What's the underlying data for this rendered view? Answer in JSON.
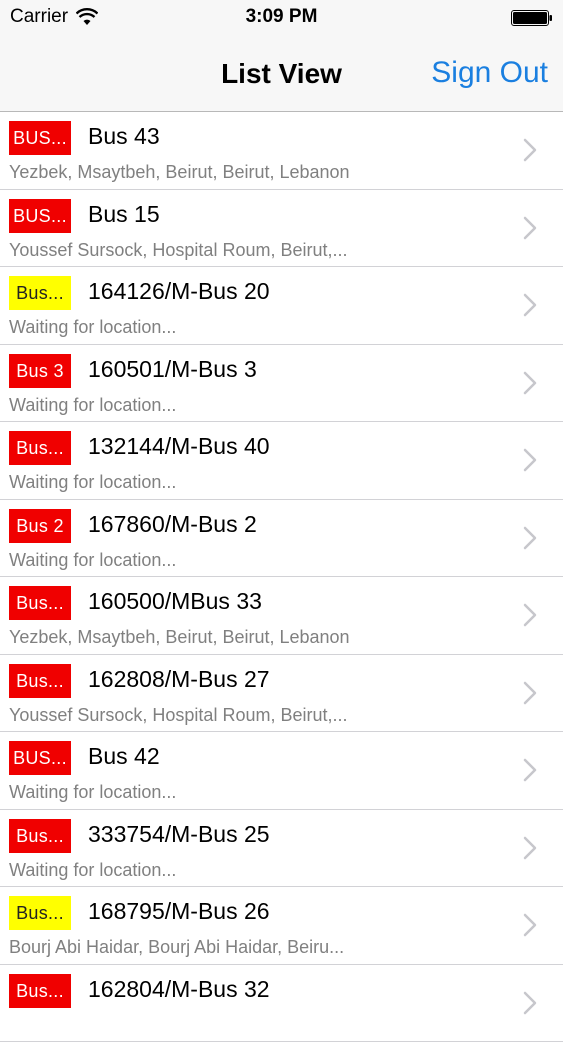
{
  "status_bar": {
    "carrier": "Carrier",
    "time": "3:09 PM"
  },
  "nav": {
    "title": "List View",
    "right_button": "Sign Out"
  },
  "colors": {
    "accent": "#1a7fe0",
    "badge_red": "#f00000",
    "badge_yellow": "#ffff00"
  },
  "rows": [
    {
      "badge": "BUS...",
      "badge_color": "#f00000",
      "title": "Bus 43",
      "subtitle": "Yezbek, Msaytbeh, Beirut, Beirut, Lebanon"
    },
    {
      "badge": "BUS...",
      "badge_color": "#f00000",
      "title": "Bus 15",
      "subtitle": "Youssef Sursock, Hospital Roum, Beirut,..."
    },
    {
      "badge": "Bus...",
      "badge_color": "#ffff00",
      "title": "164126/M-Bus 20",
      "subtitle": "Waiting for location..."
    },
    {
      "badge": "Bus 3",
      "badge_color": "#f00000",
      "title": "160501/M-Bus 3",
      "subtitle": "Waiting for location..."
    },
    {
      "badge": "Bus...",
      "badge_color": "#f00000",
      "title": "132144/M-Bus 40",
      "subtitle": "Waiting for location..."
    },
    {
      "badge": "Bus 2",
      "badge_color": "#f00000",
      "title": "167860/M-Bus 2",
      "subtitle": "Waiting for location..."
    },
    {
      "badge": "Bus...",
      "badge_color": "#f00000",
      "title": "160500/MBus 33",
      "subtitle": "Yezbek, Msaytbeh, Beirut, Beirut, Lebanon"
    },
    {
      "badge": "Bus...",
      "badge_color": "#f00000",
      "title": "162808/M-Bus 27",
      "subtitle": "Youssef Sursock, Hospital Roum, Beirut,..."
    },
    {
      "badge": "BUS...",
      "badge_color": "#f00000",
      "title": "Bus 42",
      "subtitle": "Waiting for location..."
    },
    {
      "badge": "Bus...",
      "badge_color": "#f00000",
      "title": "333754/M-Bus 25",
      "subtitle": "Waiting for location..."
    },
    {
      "badge": "Bus...",
      "badge_color": "#ffff00",
      "title": "168795/M-Bus 26",
      "subtitle": "Bourj Abi Haidar, Bourj Abi Haidar, Beiru..."
    },
    {
      "badge": "Bus...",
      "badge_color": "#f00000",
      "title": "162804/M-Bus 32",
      "subtitle": ""
    }
  ]
}
